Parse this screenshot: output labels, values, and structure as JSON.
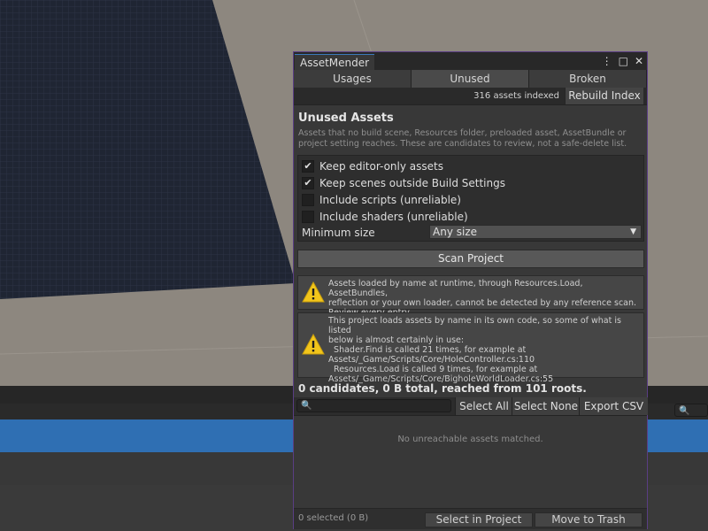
{
  "window": {
    "title": "AssetMender",
    "menu_icon": "⋮",
    "maximize_icon": "□",
    "close_icon": "✕"
  },
  "tabs": [
    "Usages",
    "Unused",
    "Broken"
  ],
  "active_tab": "Unused",
  "toolbar": {
    "indexed_text": "316 assets indexed",
    "rebuild_label": "Rebuild Index"
  },
  "section": {
    "heading": "Unused Assets",
    "description": "Assets that no build scene, Resources folder, preloaded asset, AssetBundle or project setting reaches. These are candidates to review, not a safe-delete list."
  },
  "options": [
    {
      "label": "Keep editor-only assets",
      "checked": true
    },
    {
      "label": "Keep scenes outside Build Settings",
      "checked": true
    },
    {
      "label": "Include scripts (unreliable)",
      "checked": false
    },
    {
      "label": "Include shaders (unreliable)",
      "checked": false
    }
  ],
  "min_size": {
    "label": "Minimum size",
    "value": "Any size"
  },
  "scan_label": "Scan Project",
  "warnings": [
    {
      "lines": [
        "Assets loaded by name at runtime, through Resources.Load, AssetBundles,",
        "reflection or your own loader, cannot be detected by any reference scan.",
        "Review every entry."
      ]
    },
    {
      "lines": [
        "This project loads assets by name in its own code, so some of what is listed",
        "below is almost certainly in use:",
        "  Shader.Find is called 21 times, for example at",
        "Assets/_Game/Scripts/Core/HoleController.cs:110",
        "  Resources.Load is called 9 times, for example at",
        "Assets/_Game/Scripts/Core/BigholeWorldLoader.cs:55"
      ]
    }
  ],
  "summary": "0 candidates, 0 B total, reached from 101 roots.",
  "list_toolbar": {
    "select_all": "Select All",
    "select_none": "Select None",
    "export_csv": "Export CSV"
  },
  "empty_message": "No unreachable assets matched.",
  "footer": {
    "selected": "0 selected (0 B)",
    "select_in_project": "Select in Project",
    "move_to_trash": "Move to Trash"
  },
  "colors": {
    "accent": "#3a79bb",
    "window_border": "#5a3e84",
    "warning": "#f2c51b",
    "selection": "#2f6fb3"
  }
}
